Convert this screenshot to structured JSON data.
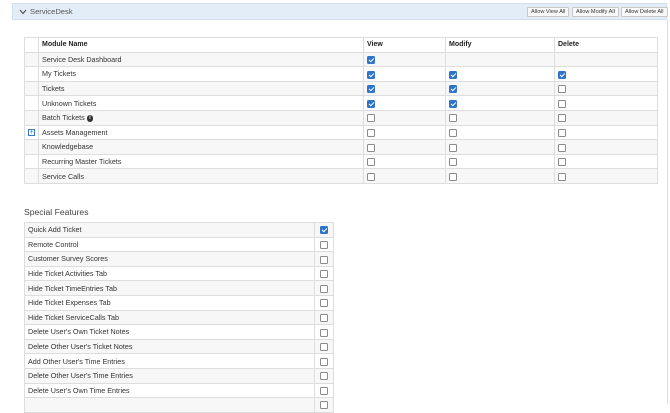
{
  "section": {
    "title": "ServiceDesk",
    "buttons": {
      "allow_view_all": "Allow View All",
      "allow_modify_all": "Allow Modify All",
      "allow_delete_all": "Allow Delete All"
    }
  },
  "permissions": {
    "headers": {
      "module": "Module Name",
      "view": "View",
      "modify": "Modify",
      "delete": "Delete"
    },
    "rows": [
      {
        "name": "Service Desk Dashboard",
        "expand": false,
        "info": false,
        "view": true,
        "modify": null,
        "delete": null
      },
      {
        "name": "My Tickets",
        "expand": false,
        "info": false,
        "view": true,
        "modify": true,
        "delete": true
      },
      {
        "name": "Tickets",
        "expand": false,
        "info": false,
        "view": true,
        "modify": true,
        "delete": false
      },
      {
        "name": "Unknown Tickets",
        "expand": false,
        "info": false,
        "view": true,
        "modify": true,
        "delete": false
      },
      {
        "name": "Batch Tickets",
        "expand": false,
        "info": true,
        "view": false,
        "modify": false,
        "delete": false
      },
      {
        "name": "Assets Management",
        "expand": true,
        "info": false,
        "view": false,
        "modify": false,
        "delete": false
      },
      {
        "name": "Knowledgebase",
        "expand": false,
        "info": false,
        "view": false,
        "modify": false,
        "delete": false
      },
      {
        "name": "Recurring Master Tickets",
        "expand": false,
        "info": false,
        "view": false,
        "modify": false,
        "delete": false
      },
      {
        "name": "Service Calls",
        "expand": false,
        "info": false,
        "view": false,
        "modify": false,
        "delete": false
      }
    ]
  },
  "special_features": {
    "title": "Special Features",
    "items": [
      {
        "label": "Quick Add Ticket",
        "checked": true
      },
      {
        "label": "Remote Control",
        "checked": false
      },
      {
        "label": "Customer Survey Scores",
        "checked": false
      },
      {
        "label": "Hide Ticket Activities Tab",
        "checked": false
      },
      {
        "label": "Hide Ticket TimeEntries Tab",
        "checked": false
      },
      {
        "label": "Hide Ticket Expenses Tab",
        "checked": false
      },
      {
        "label": "Hide Ticket ServiceCalls Tab",
        "checked": false
      },
      {
        "label": "Delete User's Own Ticket Notes",
        "checked": false
      },
      {
        "label": "Delete Other User's Ticket Notes",
        "checked": false
      },
      {
        "label": "Add Other User's Time Entries",
        "checked": false
      },
      {
        "label": "Delete Other User's Time Entries",
        "checked": false
      },
      {
        "label": "Delete User's Own Time Entries",
        "checked": false
      },
      {
        "label": "",
        "checked": false
      }
    ]
  },
  "colors": {
    "accent": "#2f74c9",
    "header_bg": "#e3edf7"
  },
  "icons": {
    "collapse": "chevron-down-icon",
    "expand": "plus-box-icon",
    "info": "info-icon"
  }
}
